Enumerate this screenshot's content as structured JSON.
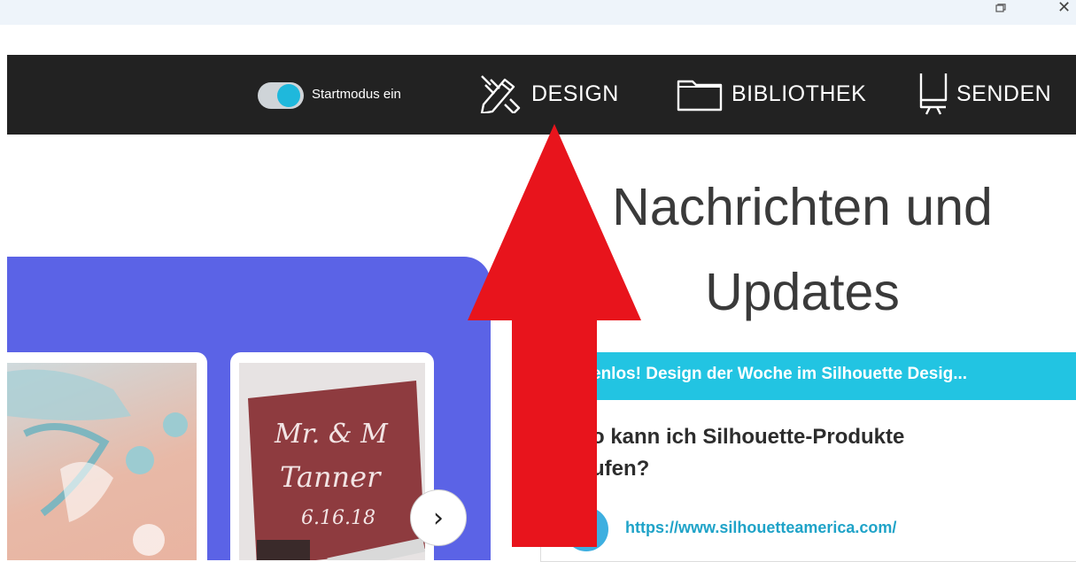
{
  "toolbar": {
    "toggle_label": "Startmodus ein",
    "design_label": "DESIGN",
    "library_label": "BIBLIOTHEK",
    "send_label": "SENDEN"
  },
  "promo": {
    "card2_text": "Mr. & M\nTanner\n6.16.18",
    "next_symbol": "›"
  },
  "news": {
    "title_line1": "Nachrichten und",
    "title_line2": "Updates",
    "banner": "enlos! Design der Woche im Silhouette Desig...",
    "question_line1": "o kann ich Silhouette-Produkte",
    "question_line2": "ufen?",
    "link": "https://www.silhouetteamerica.com/"
  },
  "colors": {
    "navbar": "#222222",
    "accent_cyan": "#22c4e2",
    "promo_blue": "#5b63e6",
    "arrow_red": "#e8141c"
  }
}
